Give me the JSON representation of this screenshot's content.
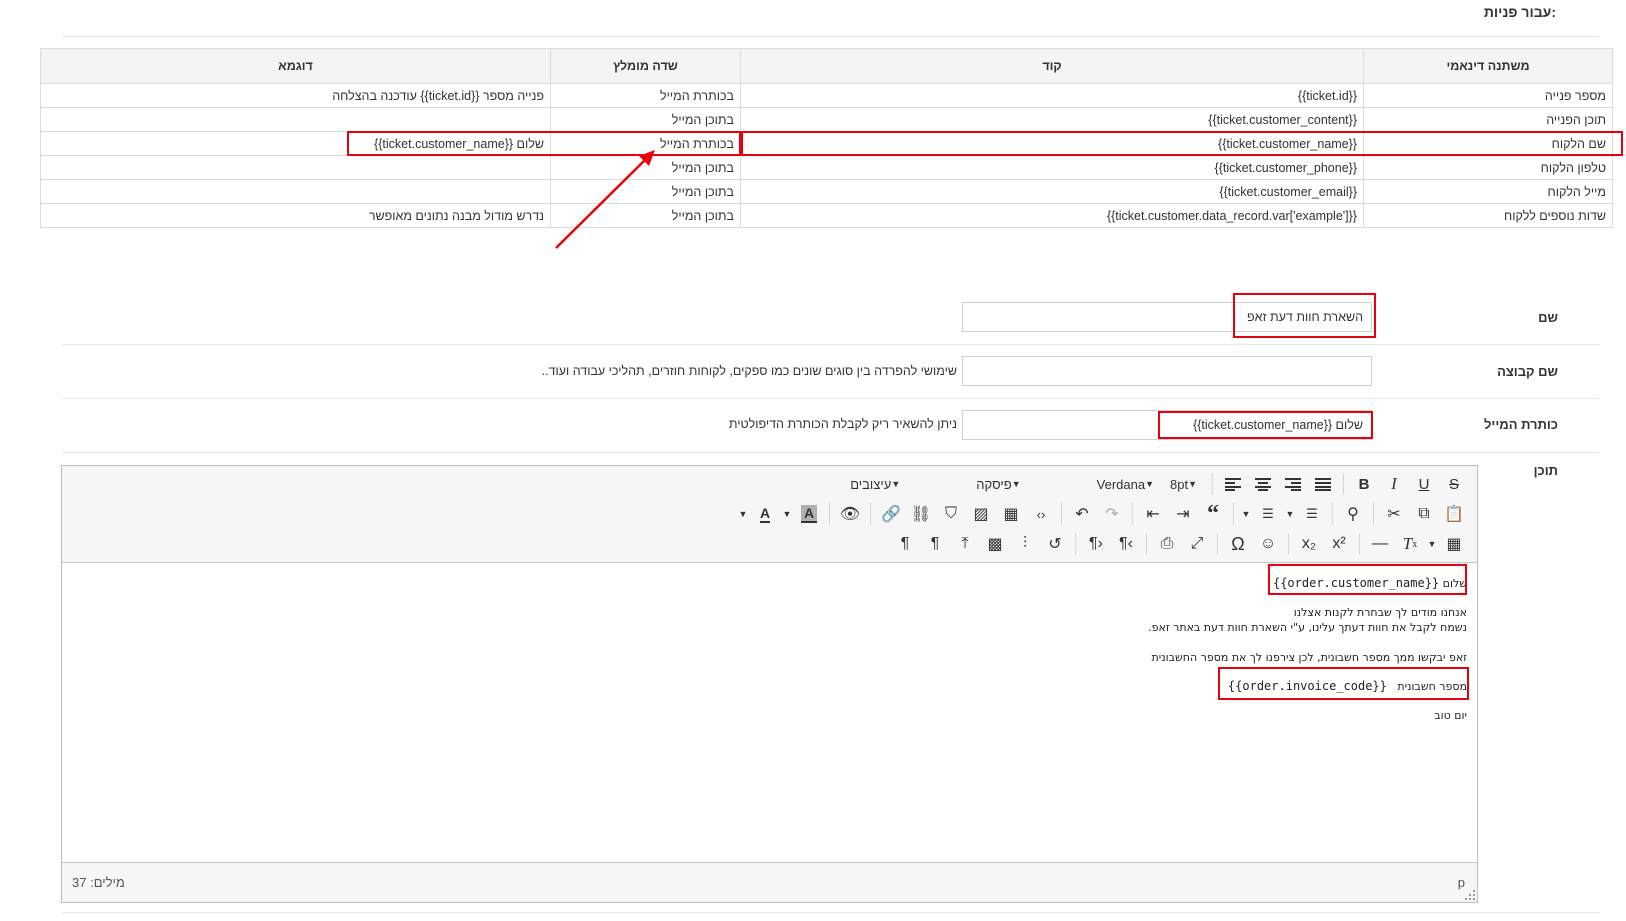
{
  "section_title": "עבור פניות:",
  "vars_table": {
    "headers": [
      "משתנה דינאמי",
      "קוד",
      "שדה מומלץ",
      "דוגמא"
    ],
    "rows": [
      [
        "מספר פנייה",
        "{{ticket.id}}",
        "בכותרת המייל",
        "פנייה מספר {{ticket.id}} עודכנה בהצלחה"
      ],
      [
        "תוכן הפנייה",
        "{{ticket.customer_content}}",
        "בתוכן המייל",
        ""
      ],
      [
        "שם הלקוח",
        "{{ticket.customer_name}}",
        "בכותרת המייל",
        "שלום {{ticket.customer_name}}"
      ],
      [
        "טלפון הלקוח",
        "{{ticket.customer_phone}}",
        "בתוכן המייל",
        ""
      ],
      [
        "מייל הלקוח",
        "{{ticket.customer_email}}",
        "בתוכן המייל",
        ""
      ],
      [
        "שדות נוספים ללקוח",
        "{{ticket.customer.data_record.var['example']}}",
        "בתוכן המייל",
        "נדרש מודול מבנה נתונים מאופשר"
      ]
    ]
  },
  "form": {
    "name": {
      "label": "שם",
      "value": "השארת חוות דעת זאפ"
    },
    "group": {
      "label": "שם קבוצה",
      "value": "",
      "help": "שימושי להפרדה בין סוגים שונים כמו ספקים, לקוחות חוזרים, תהליכי עבודה ועוד.."
    },
    "subject": {
      "label": "כותרת המייל",
      "value": "שלום {{ticket.customer_name}}",
      "help": "ניתן להשאיר ריק לקבלת הכותרת הדיפולטית"
    },
    "content": {
      "label": "תוכן"
    }
  },
  "editor": {
    "dropdowns": {
      "format": "עיצובים",
      "paragraph": "פיסקה",
      "font": "Verdana",
      "size": "8pt"
    },
    "toolbar_row1": [
      "strikethrough-icon",
      "underline-icon",
      "italic-icon",
      "bold-icon",
      "|",
      "align-justify-icon",
      "align-right-icon",
      "align-center-icon",
      "align-left-icon"
    ],
    "toolbar_row2": [
      "paste-icon",
      "copy-icon",
      "cut-icon",
      "|",
      "find-icon",
      "|",
      "numbered-list-icon",
      "bullet-list-icon",
      "|",
      "blockquote-icon",
      "indent-icon",
      "outdent-icon",
      "|",
      "redo-icon",
      "undo-icon",
      "|",
      "code-icon",
      "media-icon",
      "image-icon",
      "bookmark-icon",
      "unlink-icon",
      "link-icon",
      "|",
      "preview-icon",
      "|",
      "bg-color-icon",
      "text-color-icon"
    ],
    "toolbar_row3": [
      "table-icon",
      "clear-format-icon",
      "horizontal-rule-icon",
      "|",
      "superscript-icon",
      "subscript-icon",
      "|",
      "emoji-icon",
      "special-char-icon",
      "|",
      "fullscreen-icon",
      "print-icon",
      "|",
      "rtl-icon",
      "ltr-icon",
      "|",
      "restore-icon",
      "page-break-icon",
      "visual-blocks-icon",
      "insert-icon",
      "show-blocks-icon",
      "paragraph-mark-icon"
    ],
    "content": {
      "line1_prefix": "שלום",
      "line1_var": "{{order.customer_name}}",
      "line2": "אנחנו מודים לך שבחרת לקנות אצלנו",
      "line3": "נשמח לקבל את חוות דעתך עלינו, ע\"י השארת חוות דעת באתר זאפ.",
      "line4": "זאפ יבקשו ממך מספר חשבונית, לכן צירפנו לך את מספר החשבונית",
      "line5_prefix": "מספר חשבונית",
      "line5_var": "{{order.invoice_code}}",
      "line6": "יום טוב"
    },
    "status": {
      "path": "p",
      "words": "מילים: 37"
    }
  },
  "annotation_color": "#e8000d"
}
